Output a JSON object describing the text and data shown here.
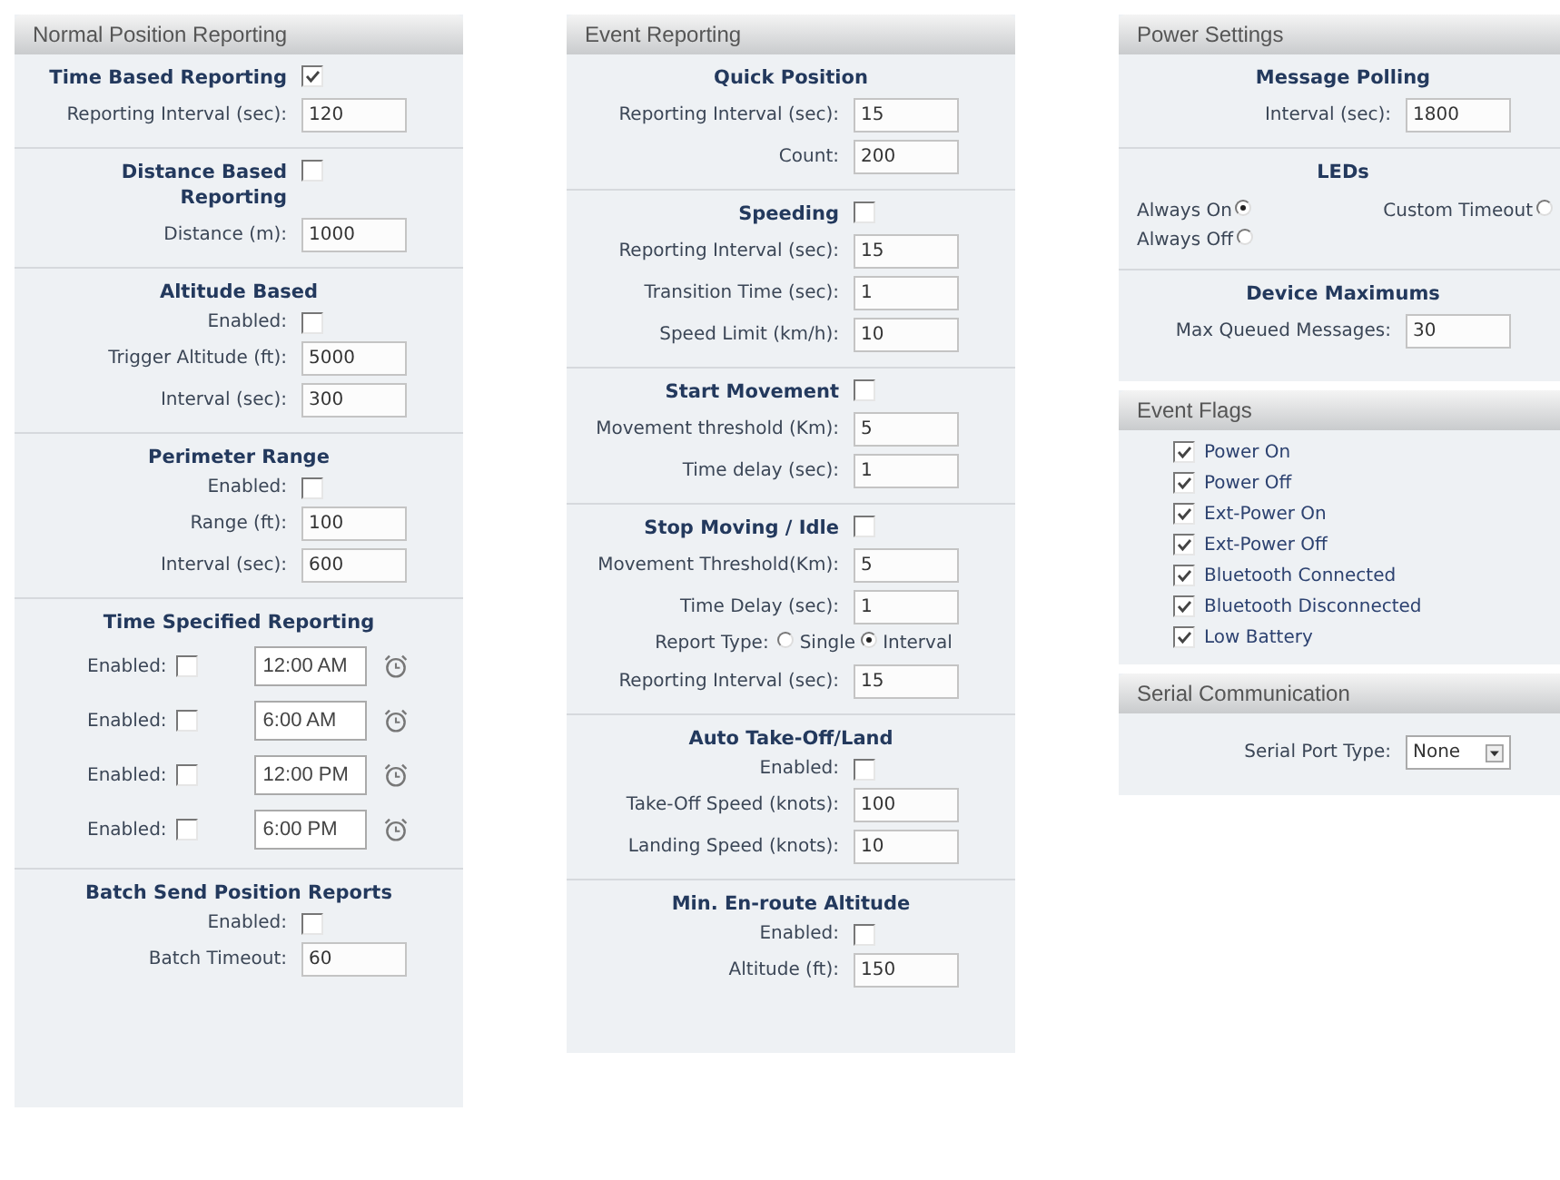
{
  "columns": [
    {
      "panels": [
        {
          "title": "Normal Position Reporting",
          "sections": [
            {
              "heading": "Time Based Reporting",
              "checked": true,
              "rows": [
                {
                  "kind": "field",
                  "label": "Reporting Interval (sec):",
                  "value": "120"
                }
              ]
            },
            {
              "heading": "Distance Based Reporting",
              "checked": false,
              "rows": [
                {
                  "kind": "field",
                  "label": "Distance (m):",
                  "value": "1000"
                }
              ]
            },
            {
              "heading": "Altitude Based",
              "rows": [
                {
                  "kind": "checkbox",
                  "label": "Enabled:",
                  "checked": false
                },
                {
                  "kind": "field",
                  "label": "Trigger Altitude (ft):",
                  "value": "5000"
                },
                {
                  "kind": "field",
                  "label": "Interval (sec):",
                  "value": "300"
                }
              ]
            },
            {
              "heading": "Perimeter Range",
              "rows": [
                {
                  "kind": "checkbox",
                  "label": "Enabled:",
                  "checked": false
                },
                {
                  "kind": "field",
                  "label": "Range (ft):",
                  "value": "100"
                },
                {
                  "kind": "field",
                  "label": "Interval (sec):",
                  "value": "600"
                }
              ]
            },
            {
              "heading": "Time Specified Reporting",
              "rows": [
                {
                  "kind": "time",
                  "label": "Enabled:",
                  "checked": false,
                  "value": "12:00 AM"
                },
                {
                  "kind": "time",
                  "label": "Enabled:",
                  "checked": false,
                  "value": "6:00 AM"
                },
                {
                  "kind": "time",
                  "label": "Enabled:",
                  "checked": false,
                  "value": "12:00 PM"
                },
                {
                  "kind": "time",
                  "label": "Enabled:",
                  "checked": false,
                  "value": "6:00 PM"
                }
              ]
            },
            {
              "heading": "Batch Send Position Reports",
              "rows": [
                {
                  "kind": "checkbox",
                  "label": "Enabled:",
                  "checked": false
                },
                {
                  "kind": "field",
                  "label": "Batch Timeout:",
                  "value": "60"
                }
              ]
            }
          ]
        }
      ]
    },
    {
      "panels": [
        {
          "title": "Event Reporting",
          "sections": [
            {
              "heading": "Quick Position",
              "rows": [
                {
                  "kind": "field",
                  "label": "Reporting Interval (sec):",
                  "value": "15"
                },
                {
                  "kind": "field",
                  "label": "Count:",
                  "value": "200"
                }
              ]
            },
            {
              "heading": "Speeding",
              "checked": false,
              "rows": [
                {
                  "kind": "field",
                  "label": "Reporting Interval (sec):",
                  "value": "15"
                },
                {
                  "kind": "field",
                  "label": "Transition Time (sec):",
                  "value": "1"
                },
                {
                  "kind": "field",
                  "label": "Speed Limit (km/h):",
                  "value": "10"
                }
              ]
            },
            {
              "heading": "Start Movement",
              "checked": false,
              "rows": [
                {
                  "kind": "field",
                  "label": "Movement threshold (Km):",
                  "value": "5"
                },
                {
                  "kind": "field",
                  "label": "Time delay (sec):",
                  "value": "1"
                }
              ]
            },
            {
              "heading": "Stop Moving / Idle",
              "checked": false,
              "rows": [
                {
                  "kind": "field",
                  "label": "Movement Threshold(Km):",
                  "value": "5"
                },
                {
                  "kind": "field",
                  "label": "Time Delay (sec):",
                  "value": "1"
                },
                {
                  "kind": "radios",
                  "label": "Report Type:",
                  "options": [
                    {
                      "label": "Single",
                      "selected": false
                    },
                    {
                      "label": "Interval",
                      "selected": true
                    }
                  ]
                },
                {
                  "kind": "field",
                  "label": "Reporting Interval (sec):",
                  "value": "15"
                }
              ]
            },
            {
              "heading": "Auto Take-Off/Land",
              "rows": [
                {
                  "kind": "checkbox",
                  "label": "Enabled:",
                  "checked": false
                },
                {
                  "kind": "field",
                  "label": "Take-Off Speed (knots):",
                  "value": "100"
                },
                {
                  "kind": "field",
                  "label": "Landing Speed (knots):",
                  "value": "10"
                }
              ]
            },
            {
              "heading": "Min. En-route Altitude",
              "rows": [
                {
                  "kind": "checkbox",
                  "label": "Enabled:",
                  "checked": false
                },
                {
                  "kind": "field",
                  "label": "Altitude (ft):",
                  "value": "150"
                }
              ]
            }
          ]
        }
      ]
    },
    {
      "panels": [
        {
          "title": "Power Settings",
          "sections": [
            {
              "heading": "Message Polling",
              "rows": [
                {
                  "kind": "field",
                  "label": "Interval (sec):",
                  "value": "1800"
                }
              ]
            },
            {
              "heading": "LEDs",
              "rows": [
                {
                  "kind": "leds",
                  "options": [
                    {
                      "label": "Always On",
                      "selected": true
                    },
                    {
                      "label": "Custom Timeout",
                      "selected": false
                    },
                    {
                      "label": "Always Off",
                      "selected": false
                    }
                  ]
                }
              ]
            },
            {
              "heading": "Device Maximums",
              "rows": [
                {
                  "kind": "field",
                  "label": "Max Queued Messages:",
                  "value": "30"
                }
              ]
            }
          ]
        },
        {
          "title": "Event Flags",
          "sections": [
            {
              "rows": [
                {
                  "kind": "flag",
                  "label": "Power On",
                  "checked": true
                },
                {
                  "kind": "flag",
                  "label": "Power Off",
                  "checked": true
                },
                {
                  "kind": "flag",
                  "label": "Ext-Power On",
                  "checked": true
                },
                {
                  "kind": "flag",
                  "label": "Ext-Power Off",
                  "checked": true
                },
                {
                  "kind": "flag",
                  "label": "Bluetooth Connected",
                  "checked": true
                },
                {
                  "kind": "flag",
                  "label": "Bluetooth Disconnected",
                  "checked": true
                },
                {
                  "kind": "flag",
                  "label": "Low Battery",
                  "checked": true
                }
              ]
            }
          ]
        },
        {
          "title": "Serial Communication",
          "sections": [
            {
              "rows": [
                {
                  "kind": "select",
                  "label": "Serial Port Type:",
                  "value": "None"
                }
              ]
            }
          ]
        }
      ]
    }
  ]
}
